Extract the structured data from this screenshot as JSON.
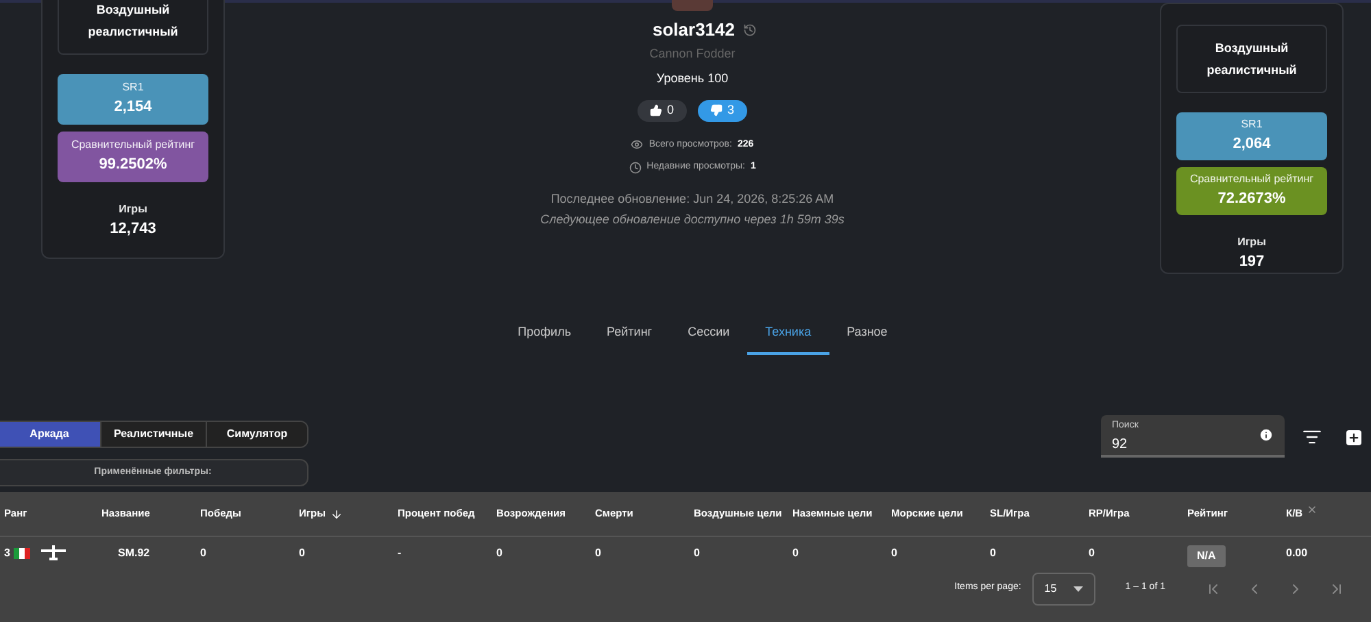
{
  "left_card": {
    "mode": "Воздушный реалистичный",
    "stats": [
      {
        "label": "SR1",
        "value": "2,154",
        "color": "#4a93b8"
      },
      {
        "label": "Сравнительный рейтинг",
        "value": "99.2502%",
        "color": "#8155a0"
      }
    ],
    "games_label": "Игры",
    "games_value": "12,743"
  },
  "profile": {
    "username": "solar3142",
    "title": "Cannon Fodder",
    "level": "Уровень 100",
    "votes": [
      {
        "kind": "like",
        "count": "0",
        "selected": false
      },
      {
        "kind": "dislike",
        "count": "3",
        "selected": true
      }
    ],
    "views": [
      {
        "kind": "total",
        "label": "Всего просмотров:",
        "value": "226"
      },
      {
        "kind": "recent",
        "label": "Недавние просмотры:",
        "value": "1"
      }
    ],
    "last_update": "Последнее обновление: Jun 24, 2026, 8:25:26 AM",
    "next_update": "Следующее обновление доступно через 1h 59m 39s"
  },
  "right_card": {
    "mode": "Воздушный реалистичный",
    "stats": [
      {
        "label": "SR1",
        "value": "2,064",
        "color": "#4a93b8"
      },
      {
        "label": "Сравнительный рейтинг",
        "value": "72.2673%",
        "color": "#6b9122"
      }
    ],
    "games_label": "Игры",
    "games_value": "197"
  },
  "nav_tabs": [
    {
      "label": "Профиль",
      "selected": false
    },
    {
      "label": "Рейтинг",
      "selected": false
    },
    {
      "label": "Сессии",
      "selected": false
    },
    {
      "label": "Техника",
      "selected": true
    },
    {
      "label": "Разное",
      "selected": false
    }
  ],
  "mode_tabs": [
    {
      "label": "Аркада",
      "selected": true
    },
    {
      "label": "Реалистичные",
      "selected": false
    },
    {
      "label": "Симулятор",
      "selected": false
    }
  ],
  "filters_label": "Применённые фильтры:",
  "search": {
    "label": "Поиск",
    "value": "92"
  },
  "table": {
    "columns": [
      {
        "label": "Ранг",
        "sorted": false,
        "removable": false
      },
      {
        "label": "Название",
        "sorted": false,
        "removable": false
      },
      {
        "label": "Победы",
        "sorted": false,
        "removable": false
      },
      {
        "label": "Игры",
        "sorted": true,
        "removable": false
      },
      {
        "label": "Процент побед",
        "sorted": false,
        "removable": false
      },
      {
        "label": "Возрождения",
        "sorted": false,
        "removable": false
      },
      {
        "label": "Смерти",
        "sorted": false,
        "removable": false
      },
      {
        "label": "Воздушные цели",
        "sorted": false,
        "removable": false
      },
      {
        "label": "Наземные цели",
        "sorted": false,
        "removable": false
      },
      {
        "label": "Морские цели",
        "sorted": false,
        "removable": false
      },
      {
        "label": "SL/Игра",
        "sorted": false,
        "removable": false
      },
      {
        "label": "RP/Игра",
        "sorted": false,
        "removable": false
      },
      {
        "label": "Рейтинг",
        "sorted": false,
        "removable": false
      },
      {
        "label": "К/В",
        "sorted": false,
        "removable": true
      }
    ],
    "rows": [
      {
        "cells": [
          {
            "kind": "rank",
            "text": "3"
          },
          {
            "kind": "name",
            "text": "SM.92"
          },
          {
            "kind": "text",
            "text": "0"
          },
          {
            "kind": "text",
            "text": "0"
          },
          {
            "kind": "text",
            "text": "-"
          },
          {
            "kind": "text",
            "text": "0"
          },
          {
            "kind": "text",
            "text": "0"
          },
          {
            "kind": "text",
            "text": "0"
          },
          {
            "kind": "text",
            "text": "0"
          },
          {
            "kind": "text",
            "text": "0"
          },
          {
            "kind": "text",
            "text": "0"
          },
          {
            "kind": "text",
            "text": "0"
          },
          {
            "kind": "badge",
            "text": "N/A"
          },
          {
            "kind": "text",
            "text": "0.00"
          }
        ]
      }
    ]
  },
  "paginator": {
    "label": "Items per page:",
    "page_size": "15",
    "range": "1 – 1 of 1"
  }
}
